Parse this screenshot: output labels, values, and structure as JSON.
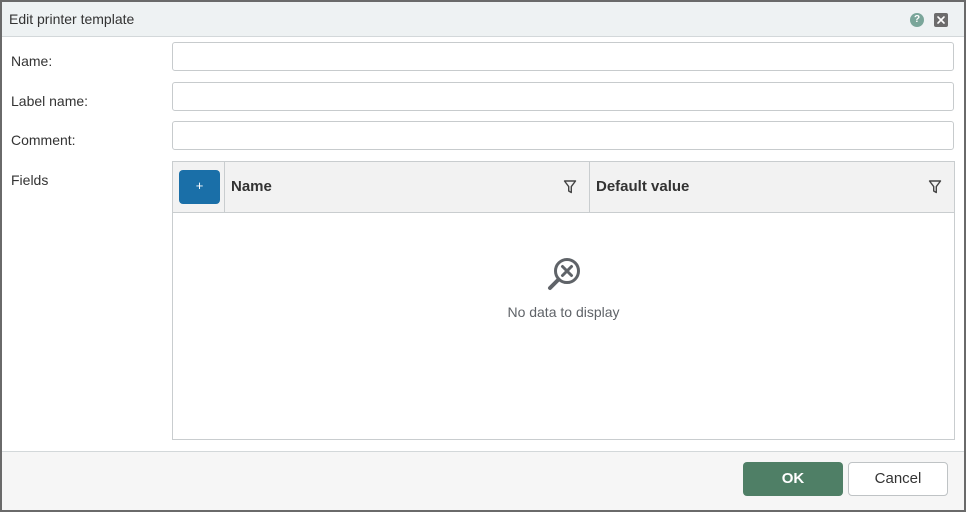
{
  "dialog": {
    "title": "Edit printer template",
    "help_glyph": "?",
    "colors": {
      "titlebar_bg": "#eef2f3",
      "accent_blue": "#1a6fa8",
      "ok_green": "#4f7f66"
    }
  },
  "form": {
    "name": {
      "label": "Name:",
      "value": "",
      "placeholder": ""
    },
    "label_name": {
      "label": "Label name:",
      "value": "",
      "placeholder": ""
    },
    "comment": {
      "label": "Comment:",
      "value": "",
      "placeholder": ""
    },
    "fields_label": "Fields"
  },
  "fields_grid": {
    "add_button_label": "+",
    "columns": [
      "Name",
      "Default value"
    ],
    "rows": [],
    "empty_message": "No data to display",
    "icons": {
      "filter": "filter-icon",
      "empty": "no-data-magnifier-icon"
    }
  },
  "footer": {
    "ok_label": "OK",
    "cancel_label": "Cancel"
  }
}
